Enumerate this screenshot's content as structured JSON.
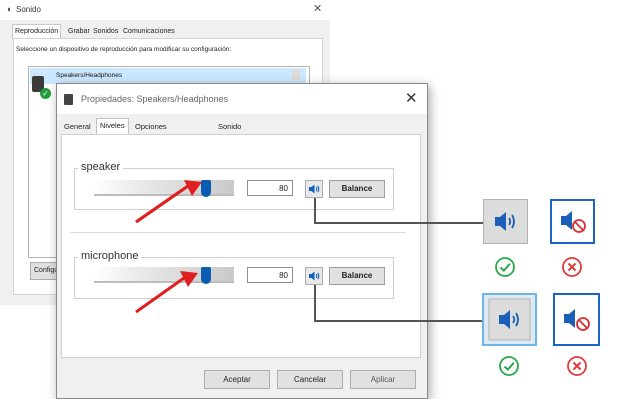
{
  "sound_window": {
    "title": "Sonido",
    "tabs": [
      "Reproducción",
      "Grabar",
      "Sonidos",
      "Comunicaciones"
    ],
    "instruction": "Seleccione un dispositivo de reproducción para modificar su configuración:",
    "device_name": "Speakers/Headphones",
    "configure_label": "Configurar"
  },
  "props_window": {
    "title": "Propiedades: Speakers/Headphones",
    "tabs": [
      "General",
      "Niveles",
      "Opciones avanzadas",
      "Sonido espacial"
    ],
    "active_tab": "Niveles",
    "groups": [
      {
        "label": "speaker",
        "level": "80",
        "level_percent": 80,
        "balance_label": "Balance"
      },
      {
        "label": "microphone",
        "level": "80",
        "level_percent": 80,
        "balance_label": "Balance"
      }
    ],
    "buttons": {
      "ok": "Aceptar",
      "cancel": "Cancelar",
      "apply": "Aplicar"
    }
  },
  "legend": {
    "icons": [
      "speaker-on-icon",
      "speaker-muted-icon"
    ],
    "correct_mark": "check-icon",
    "wrong_mark": "x-icon"
  },
  "colors": {
    "accent_blue": "#0a5cb3",
    "arrow_red": "#e02020",
    "check_green": "#2aa84a",
    "cross_red": "#e23b3b",
    "icon_frame_blue": "#1e64c8"
  }
}
